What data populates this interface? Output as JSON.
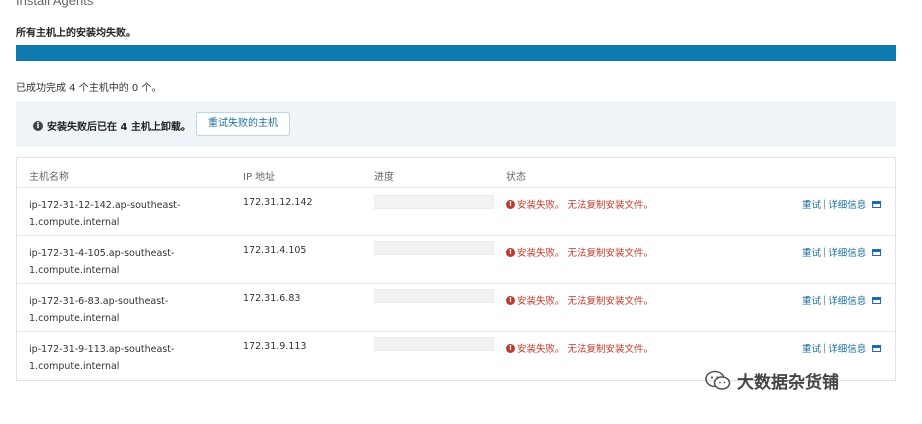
{
  "page": {
    "title": "Install Agents"
  },
  "status_message": "所有主机上的安装均失败。",
  "progress": {
    "percent": 100,
    "color": "#0f7bb0"
  },
  "summary": "已成功完成 4 个主机中的 0 个。",
  "banner": {
    "text": "安装失败后已在 4 主机上卸载。",
    "retry_button": "重试失败的主机"
  },
  "table": {
    "headers": {
      "host": "主机名称",
      "ip": "IP 地址",
      "progress": "进度",
      "status": "状态"
    },
    "rows": [
      {
        "host_line1": "ip-172-31-12-142.ap-southeast-",
        "host_line2": "1.compute.internal",
        "ip": "172.31.12.142",
        "status": "安装失败。 无法复制安装文件。",
        "retry": "重试",
        "details": "详细信息"
      },
      {
        "host_line1": "ip-172-31-4-105.ap-southeast-",
        "host_line2": "1.compute.internal",
        "ip": "172.31.4.105",
        "status": "安装失败。 无法复制安装文件。",
        "retry": "重试",
        "details": "详细信息"
      },
      {
        "host_line1": "ip-172-31-6-83.ap-southeast-",
        "host_line2": "1.compute.internal",
        "ip": "172.31.6.83",
        "status": "安装失败。 无法复制安装文件。",
        "retry": "重试",
        "details": "详细信息"
      },
      {
        "host_line1": "ip-172-31-9-113.ap-southeast-",
        "host_line2": "1.compute.internal",
        "ip": "172.31.9.113",
        "status": "安装失败。 无法复制安装文件。",
        "retry": "重试",
        "details": "详细信息"
      }
    ]
  },
  "watermark": "大数据杂货铺"
}
